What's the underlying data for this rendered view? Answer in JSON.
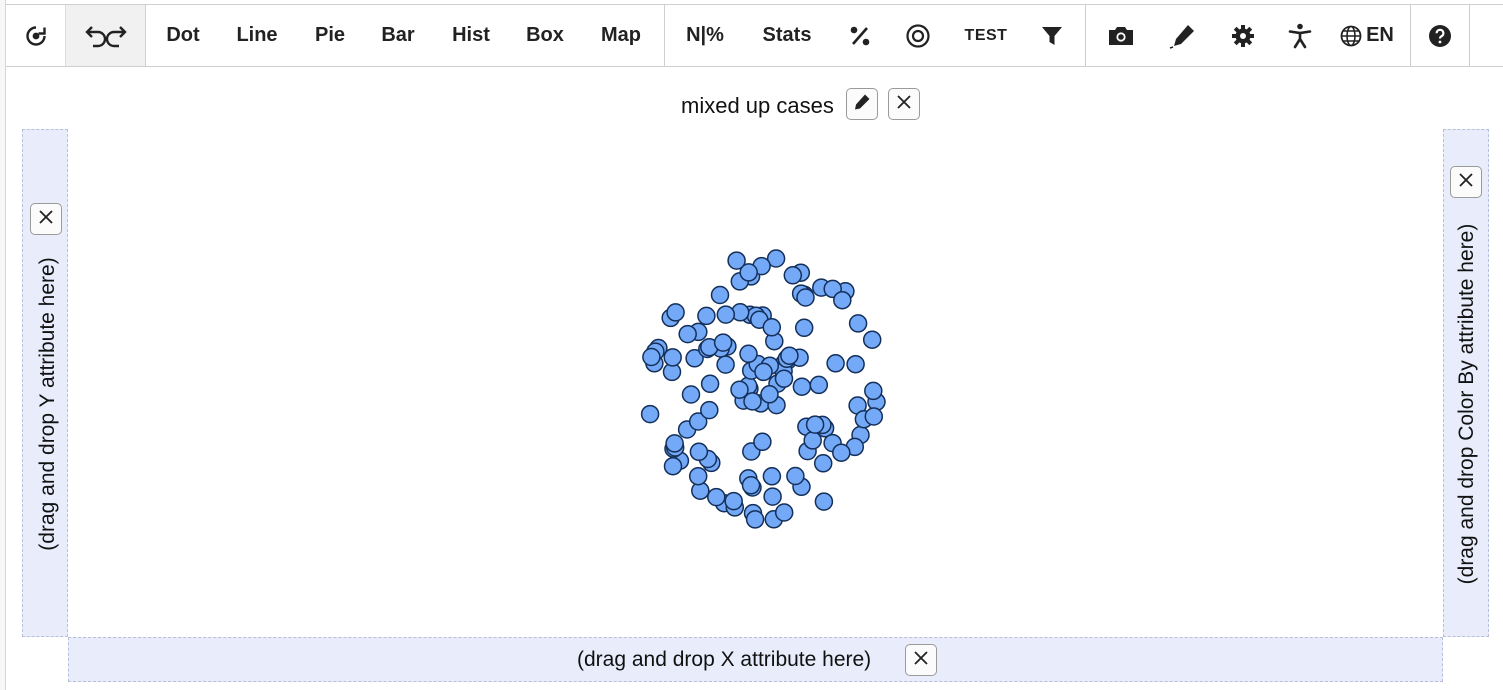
{
  "toolbar": {
    "buttons": [
      "Dot",
      "Line",
      "Pie",
      "Bar",
      "Hist",
      "Box",
      "Map"
    ],
    "count_toggle": "N|%",
    "stats": "Stats",
    "test": "TEST",
    "language": "EN",
    "icons": [
      "rerandomize-icon",
      "undo-redo-icon",
      "percent-icon",
      "target-icon",
      "filter-icon",
      "camera-icon",
      "pen-icon",
      "gear-icon",
      "accessibility-icon",
      "globe-icon",
      "help-icon"
    ]
  },
  "graph": {
    "title": "mixed up cases",
    "y_drop": "(drag and drop Y attribute here)",
    "x_drop": "(drag and drop X attribute here)",
    "color_drop": "(drag and drop Color By attribute here)"
  },
  "colors": {
    "point_fill": "#74a9f7",
    "point_stroke": "#14305a",
    "drop_zone": "#e9edfb"
  },
  "chart_data": {
    "type": "scatter",
    "title": "mixed up cases",
    "xlabel": "",
    "ylabel": "",
    "point_count": 120
  }
}
